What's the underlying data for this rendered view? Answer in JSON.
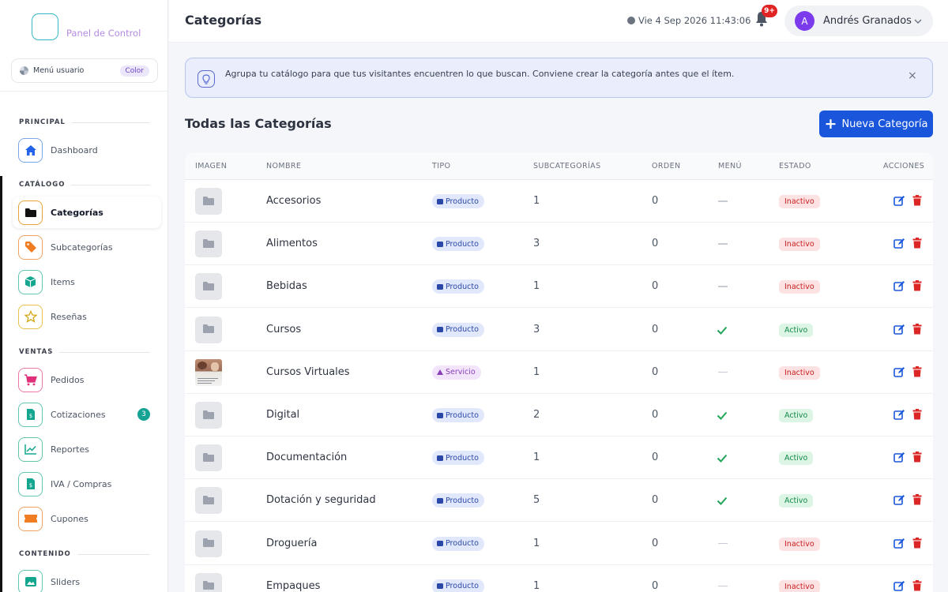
{
  "brand": {
    "logo_text": "Panel de Control"
  },
  "user_menu": {
    "label": "Menú usuario",
    "chip": "Color"
  },
  "sidebar": {
    "sections": [
      {
        "title": "PRINCIPAL"
      },
      {
        "title": "CATÁLOGO"
      },
      {
        "title": "VENTAS"
      },
      {
        "title": "CONTENIDO"
      }
    ],
    "items": [
      {
        "label": "Dashboard",
        "icon": "home-icon"
      },
      {
        "label": "Categorías",
        "icon": "folder-icon"
      },
      {
        "label": "Subcategorías",
        "icon": "tag-icon"
      },
      {
        "label": "Items",
        "icon": "cube-icon"
      },
      {
        "label": "Reseñas",
        "icon": "star-icon"
      },
      {
        "label": "Pedidos",
        "icon": "cart-icon"
      },
      {
        "label": "Cotizaciones",
        "icon": "invoice-icon",
        "badge": "3"
      },
      {
        "label": "Reportes",
        "icon": "chart-line-icon"
      },
      {
        "label": "IVA / Compras",
        "icon": "invoice-dollar-icon"
      },
      {
        "label": "Cupones",
        "icon": "ticket-icon"
      },
      {
        "label": "Sliders",
        "icon": "images-icon"
      }
    ]
  },
  "header": {
    "title": "Categorías",
    "datetime": "Vie 4 Sep 2026 11:43:06",
    "notifications_badge": "9+",
    "user": {
      "initial": "A",
      "name": "Andrés Granados"
    }
  },
  "alert": {
    "text": "Agrupa tu catálogo para que tus visitantes encuentren lo que buscan. Conviene crear la categoría antes que el ítem.",
    "close": "×"
  },
  "list": {
    "title": "Todas las Categorías",
    "new_button": "Nueva Categoría"
  },
  "table": {
    "headers": [
      "IMAGEN",
      "NOMBRE",
      "TIPO",
      "SUBCATEGORÍAS",
      "ORDEN",
      "MENÚ",
      "ESTADO",
      "ACCIONES"
    ],
    "rows": [
      {
        "name": "Accesorios",
        "type": "Producto",
        "sub": "1",
        "order": "0",
        "menu": false,
        "status": "Inactivo",
        "image": false
      },
      {
        "name": "Alimentos",
        "type": "Producto",
        "sub": "3",
        "order": "0",
        "menu": false,
        "status": "Inactivo",
        "image": false
      },
      {
        "name": "Bebidas",
        "type": "Producto",
        "sub": "1",
        "order": "0",
        "menu": false,
        "status": "Inactivo",
        "image": false
      },
      {
        "name": "Cursos",
        "type": "Producto",
        "sub": "3",
        "order": "0",
        "menu": true,
        "status": "Activo",
        "image": false
      },
      {
        "name": "Cursos Virtuales",
        "type": "Servicio",
        "sub": "1",
        "order": "0",
        "menu": false,
        "status": "Inactivo",
        "image": true
      },
      {
        "name": "Digital",
        "type": "Producto",
        "sub": "2",
        "order": "0",
        "menu": true,
        "status": "Activo",
        "image": false
      },
      {
        "name": "Documentación",
        "type": "Producto",
        "sub": "1",
        "order": "0",
        "menu": true,
        "status": "Activo",
        "image": false
      },
      {
        "name": "Dotación y seguridad",
        "type": "Producto",
        "sub": "5",
        "order": "0",
        "menu": true,
        "status": "Activo",
        "image": false
      },
      {
        "name": "Droguería",
        "type": "Producto",
        "sub": "1",
        "order": "0",
        "menu": false,
        "status": "Inactivo",
        "image": false
      },
      {
        "name": "Empaques",
        "type": "Producto",
        "sub": "1",
        "order": "0",
        "menu": false,
        "status": "Inactivo",
        "image": false
      }
    ]
  },
  "colors": {
    "primary": "#1a56db",
    "active_green": "#138a48",
    "inactive_red": "#c81e1e",
    "badge_teal": "#16a394",
    "avatar_purple": "#7c3aed"
  }
}
